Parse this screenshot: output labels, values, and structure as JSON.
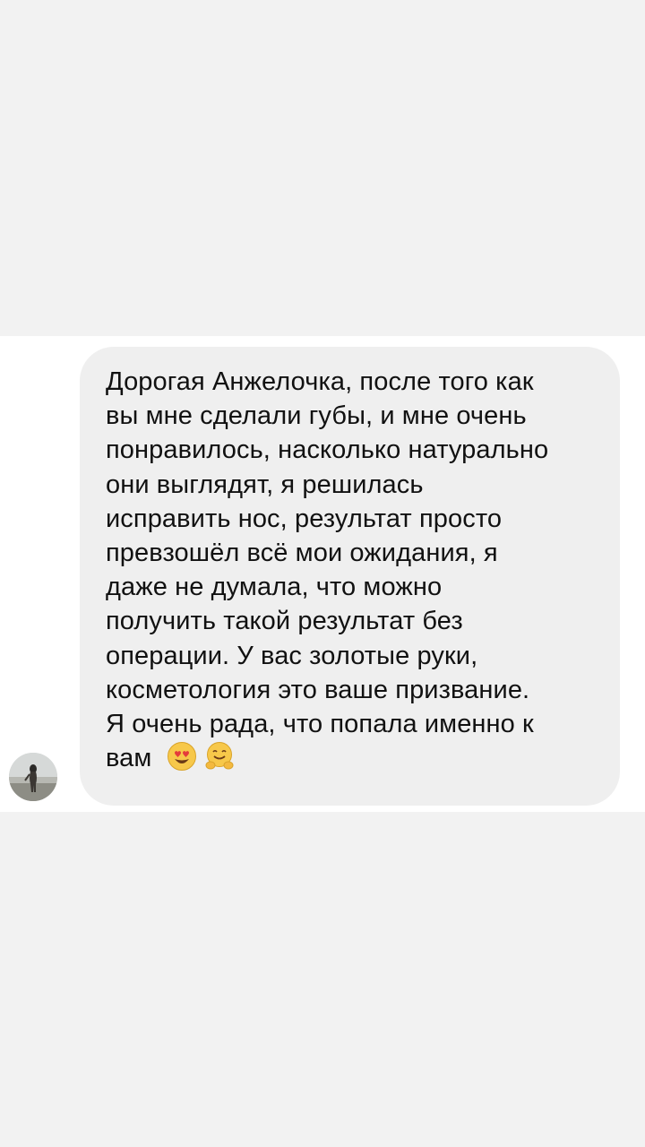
{
  "conversation": {
    "avatar_icon": "user-avatar-beach-photo",
    "message": {
      "lines": [
        "Дорогая Анжелочка, после того как",
        "вы мне сделали губы, и мне очень",
        "понравилось, насколько натурально",
        "они выглядят, я решилась",
        "исправить нос, результат просто",
        "превзошёл всё мои ожидания, я",
        "даже не думала, что можно",
        "получить такой результат без",
        "операции. У вас золотые руки,",
        "косметология это ваше призвание.",
        "Я очень рада, что попала именно к",
        "вам"
      ],
      "emojis": [
        "heart-eyes-emoji",
        "hugging-face-emoji"
      ]
    }
  },
  "colors": {
    "page_background": "#f2f2f2",
    "chat_background": "#ffffff",
    "bubble_background": "#efefef",
    "text": "#111111"
  }
}
